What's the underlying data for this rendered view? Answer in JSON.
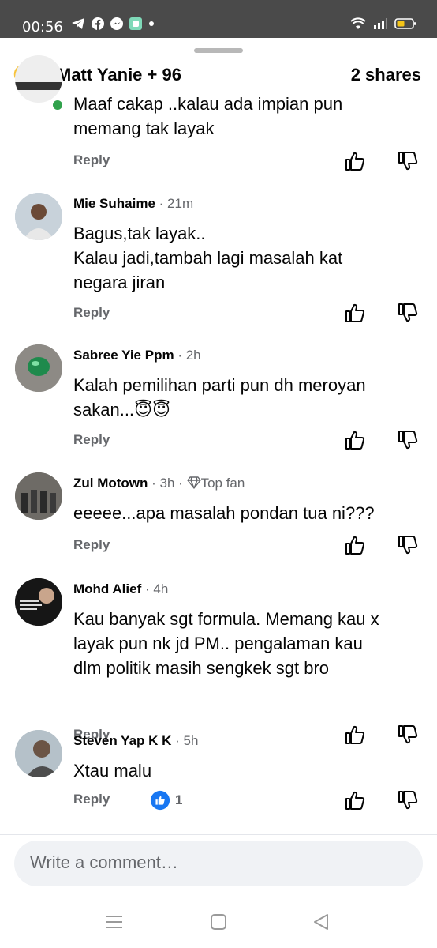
{
  "status": {
    "time": "00:56",
    "icons": [
      "telegram-icon",
      "facebook-icon",
      "messenger-icon",
      "app-icon",
      "dot-icon"
    ],
    "right_icons": [
      "wifi-icon",
      "signal-icon",
      "battery-icon"
    ]
  },
  "header": {
    "reactor_text": "Matt Yanie + 96",
    "shares_text": "2 shares",
    "reaction_icons": [
      "haha-icon",
      "like-icon"
    ]
  },
  "comments": [
    {
      "author": "",
      "time": "",
      "text_lines": [
        "Maaf cakap ..kalau ada impian pun",
        "memang tak layak"
      ],
      "reply_label": "Reply"
    },
    {
      "author": "Mie Suhaime",
      "time": "· 21m",
      "text_lines": [
        "Bagus,tak layak..",
        "Kalau jadi,tambah lagi masalah kat",
        "negara jiran"
      ],
      "reply_label": "Reply"
    },
    {
      "author": "Sabree Yie Ppm",
      "time": "· 2h",
      "text_lines": [
        "Kalah pemilihan parti pun dh meroyan",
        "sakan...😇😇"
      ],
      "reply_label": "Reply"
    },
    {
      "author": "Zul Motown",
      "time": "· 3h ·",
      "badge": "Top fan",
      "text_lines": [
        "eeeee...apa masalah pondan tua ni???"
      ],
      "reply_label": "Reply"
    },
    {
      "author": "Mohd Alief",
      "time": "· 4h",
      "text_lines": [
        "Kau banyak sgt formula. Memang kau x",
        "layak pun nk jd PM.. pengalaman kau",
        "dlm politik masih sengkek sgt bro"
      ],
      "reply_label": "Reply"
    },
    {
      "author": "Steven Yap K K",
      "time": "· 5h",
      "text_lines": [
        "Xtau malu"
      ],
      "reply_label": "Reply",
      "like_count": "1"
    }
  ],
  "composer": {
    "placeholder": "Write a comment…"
  },
  "navbar": {
    "icons": [
      "menu-icon",
      "home-square-icon",
      "back-icon"
    ]
  },
  "colors": {
    "status_bar": "#4a4a4a",
    "secondary_text": "#65676b",
    "like_blue": "#1877f2",
    "composer_bg": "#f0f2f5"
  }
}
